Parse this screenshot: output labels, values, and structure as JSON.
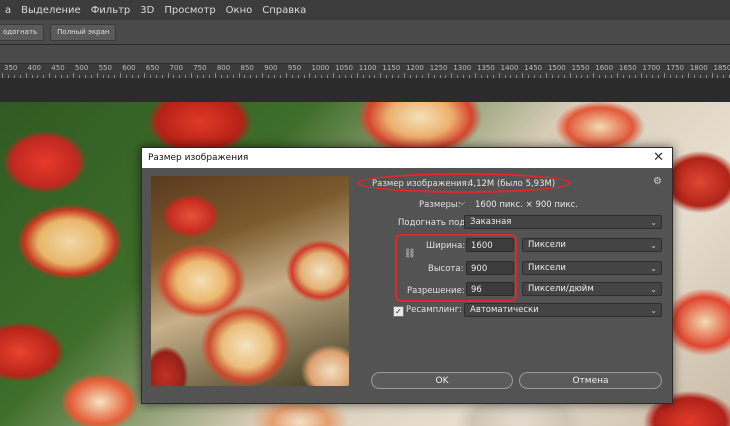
{
  "menubar": {
    "items": [
      "а",
      "Выделение",
      "Фильтр",
      "3D",
      "Просмотр",
      "Окно",
      "Справка"
    ]
  },
  "optionsbar": {
    "buttons": [
      "одогнать",
      "Полный экран"
    ]
  },
  "ruler": {
    "ticks": [
      "350",
      "400",
      "450",
      "500",
      "550",
      "600",
      "650",
      "700",
      "750",
      "800",
      "850",
      "900",
      "950",
      "1000",
      "1050",
      "1100",
      "1150",
      "1200",
      "1250",
      "1300",
      "1350",
      "1400",
      "1450",
      "1500",
      "1550",
      "1600",
      "1650",
      "1700",
      "1750",
      "1800",
      "1850"
    ]
  },
  "dialog": {
    "title": "Размер изображения",
    "close": "✕",
    "gear": "⚙",
    "image_size_label": "Размер изображения:",
    "image_size_value": "4,12M (было 5,93M)",
    "dims_label": "Размеры:",
    "dims_value": "1600 пикс.  ×  900 пикс.",
    "fit_label": "Подогнать под:",
    "fit_value": "Заказная",
    "width_label": "Ширина:",
    "width_value": "1600",
    "width_unit": "Пиксели",
    "height_label": "Высота:",
    "height_value": "900",
    "height_unit": "Пиксели",
    "resolution_label": "Разрешение:",
    "resolution_value": "96",
    "resolution_unit": "Пиксели/дюйм",
    "resample_label": "Ресамплинг:",
    "resample_value": "Автоматически",
    "resample_checked": "✓",
    "ok": "OK",
    "cancel": "Отмена"
  },
  "colors": {
    "annotation": "#e3262a",
    "dialog_bg": "#535353"
  }
}
